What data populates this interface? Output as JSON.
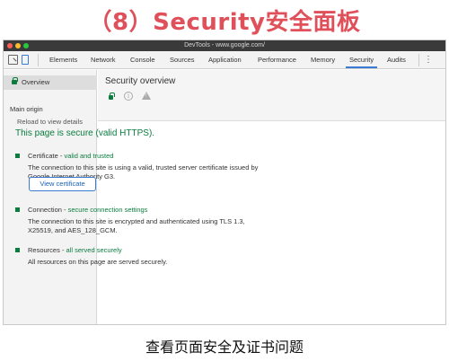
{
  "slide": {
    "title": "（8）Security安全面板",
    "caption": "查看页面安全及证书问题"
  },
  "window": {
    "title": "DevTools - www.google.com/"
  },
  "toolbar": {
    "tabs": [
      {
        "label": "Elements",
        "active": false
      },
      {
        "label": "Network",
        "active": false
      },
      {
        "label": "Console",
        "active": false
      },
      {
        "label": "Sources",
        "active": false
      },
      {
        "label": "Application",
        "active": false
      },
      {
        "label": "Performance",
        "active": false
      },
      {
        "label": "Memory",
        "active": false
      },
      {
        "label": "Security",
        "active": true
      },
      {
        "label": "Audits",
        "active": false
      }
    ],
    "more_icon": "⋮"
  },
  "sidebar": {
    "overview_label": "Overview",
    "main_origin_label": "Main origin",
    "reload_label": "Reload to view details"
  },
  "main": {
    "title": "Security overview",
    "info_glyph": "i",
    "warn_glyph": "!",
    "secure_text": "This page is secure (valid HTTPS).",
    "items": [
      {
        "name": "Certificate",
        "status": "valid and trusted",
        "description": "The connection to this site is using a valid, trusted server certificate issued by Google Internet Authority G3."
      },
      {
        "name": "Connection",
        "status": "secure connection settings",
        "description": "The connection to this site is encrypted and authenticated using TLS 1.3, X25519, and AES_128_GCM."
      },
      {
        "name": "Resources",
        "status": "all served securely",
        "description": "All resources on this page are served securely."
      }
    ],
    "view_certificate_label": "View certificate"
  },
  "colors": {
    "secure_green": "#0a7d3e",
    "title_red": "#e0505a",
    "link_blue": "#1a5fb4"
  }
}
